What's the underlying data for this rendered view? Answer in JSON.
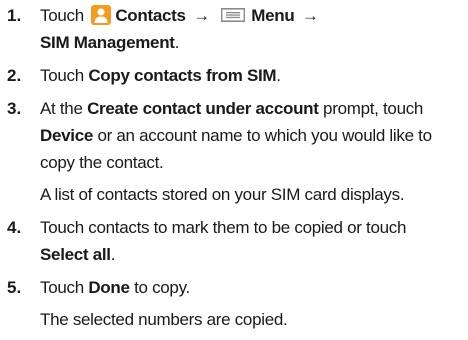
{
  "steps": [
    {
      "number": "1.",
      "touch": "Touch",
      "contacts": "Contacts",
      "arrow1": "→",
      "menu": "Menu",
      "arrow2": "→",
      "sim_management": "SIM Management",
      "period": "."
    },
    {
      "number": "2.",
      "touch": "Touch",
      "copy_contacts": "Copy contacts from SIM",
      "period": "."
    },
    {
      "number": "3.",
      "at_the": "At the",
      "create_contact": "Create contact under account",
      "prompt_touch": "prompt, touch",
      "device": "Device",
      "rest": "or an account name to which you would like to",
      "rest2": "copy the contact.",
      "note": "A list of contacts stored on your SIM card displays."
    },
    {
      "number": "4.",
      "text": "Touch contacts to mark them to be copied or touch",
      "select_all": "Select all",
      "period": "."
    },
    {
      "number": "5.",
      "touch": "Touch",
      "done": "Done",
      "to_copy": "to copy.",
      "note": "The selected numbers are copied."
    }
  ],
  "icons": {
    "contacts_icon": "contacts-app-icon",
    "menu_icon": "menu-icon",
    "contacts_color": "#f49a1e"
  }
}
